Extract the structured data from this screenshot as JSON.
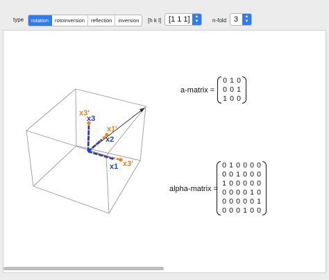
{
  "controls": {
    "type_label": "type",
    "type_options": [
      "rotation",
      "rotoinversion",
      "reflection",
      "inversion"
    ],
    "selected_type": "rotation",
    "hkl_label": "[h k l]",
    "hkl_value": "[1 1 1]",
    "nfold_label": "n-fold",
    "nfold_value": "3"
  },
  "plot": {
    "axis_labels": [
      "x3",
      "x3'",
      "x1'",
      "x2",
      "x1",
      "x3'"
    ],
    "colors": {
      "primary_axes": "#1a3fd6",
      "rotated_axes": "#f07f1a",
      "box": "#9a9a9a",
      "accent": "#2f7bf5"
    }
  },
  "a_matrix": {
    "label": "a-matrix =",
    "rows": [
      [
        "0",
        "1",
        "0"
      ],
      [
        "0",
        "0",
        "1"
      ],
      [
        "1",
        "0",
        "0"
      ]
    ]
  },
  "alpha_matrix": {
    "label": "alpha-matrix =",
    "rows": [
      [
        "0",
        "1",
        "0",
        "0",
        "0",
        "0"
      ],
      [
        "0",
        "0",
        "1",
        "0",
        "0",
        "0"
      ],
      [
        "1",
        "0",
        "0",
        "0",
        "0",
        "0"
      ],
      [
        "0",
        "0",
        "0",
        "0",
        "1",
        "0"
      ],
      [
        "0",
        "0",
        "0",
        "0",
        "0",
        "1"
      ],
      [
        "0",
        "0",
        "0",
        "1",
        "0",
        "0"
      ]
    ]
  }
}
